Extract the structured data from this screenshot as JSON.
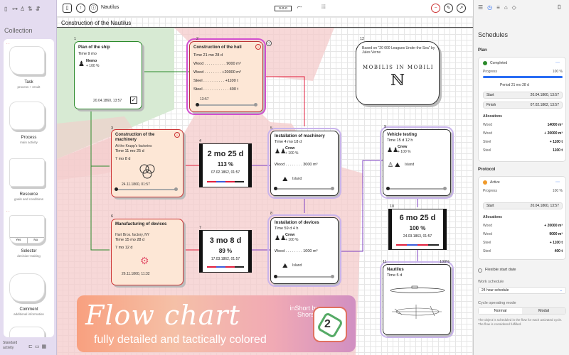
{
  "app": {
    "title": "Nautilus",
    "collection_label": "Collection"
  },
  "sidebar": {
    "shapes": [
      {
        "name": "Task",
        "sub": "process + result"
      },
      {
        "name": "Process",
        "sub": "main activity"
      },
      {
        "name": "Resource",
        "sub": "goals and conditions"
      },
      {
        "name": "Selector",
        "sub": "decision-making",
        "yes": "Yes",
        "no": "No"
      },
      {
        "name": "Comment",
        "sub": "additional information"
      }
    ],
    "footer": "Standard activity"
  },
  "canvas": {
    "title": "Construction of the Nautilus"
  },
  "nodes": {
    "plan": {
      "num": "1",
      "title": "Plan of the ship",
      "time": "Time 9 mo",
      "res": "Nemo",
      "pct": "+ 100 %",
      "date": "20.04.1860, 13:57"
    },
    "hull": {
      "num": "2",
      "title": "Construction of the hull",
      "time": "Time 21 mo 28 d",
      "wood": "Wood . . . . . . . . . . 9000 m³",
      "wood2": "Wood . . . . . . . . +20000 m³",
      "steel": "Steel . . . . . . . . . . +1100 t",
      "steel2": "Steel . . . . . . . . . . . . 400 t",
      "date": "13:57"
    },
    "machinery": {
      "num": "3",
      "title": "Construction of the machinery",
      "place": "At the Krupp's factories",
      "time": "Time 11 mo 25 d",
      "dur": "7 mo 8 d",
      "date": "24.11.1860, 01:57"
    },
    "dur1": {
      "num": "4",
      "big": "2 mo 25 d",
      "pct": "113 %",
      "date": "07.02.1862, 01:57"
    },
    "instmach": {
      "num": "5",
      "title": "Installation of machinery",
      "time": "Time 4 mo 18 d",
      "crew": "Crew",
      "pct": "+ 100 %",
      "wood": "Wood . . . . . . . . 3000 m³",
      "island": "Island"
    },
    "devices": {
      "num": "6",
      "title": "Manufacturing of devices",
      "place": "Hart Bros. factory, NY",
      "time": "Time 15 mo 28 d",
      "dur": "7 mo 12 d",
      "date": "26.11.1860, 11:32"
    },
    "dur2": {
      "num": "7",
      "big": "3 mo 8 d",
      "pct": "89 %",
      "date": "17.03.1862, 01:57"
    },
    "instdev": {
      "num": "8",
      "title": "Installation of devices",
      "time": "Time 59 d 4 h",
      "crew": "Crew",
      "pct": "+ 100 %",
      "wood": "Wood . . . . . . . . 1000 m³",
      "island": "Island"
    },
    "testing": {
      "num": "9",
      "title": "Vehicle testing",
      "time": "Time 15 d 12 h",
      "crew": "Crew",
      "pct": "+ 100 %",
      "island": "Island"
    },
    "dur3": {
      "num": "10",
      "big": "6 mo 25 d",
      "pct": "100 %",
      "date": "24.03.1863, 01:57"
    },
    "nautilus": {
      "num": "11",
      "title": "Nautilus",
      "time": "Time 5 d",
      "pct": "100%"
    },
    "note": {
      "num": "12",
      "text": "Based on \"20 000 Leagues Under the Sea\" by Jules Verne",
      "motto": "MOBILIS IN MOBILI"
    }
  },
  "banner": {
    "title": "Flow chart",
    "subtitle": "fully detailed and tactically colored",
    "brand": "inShort by Shorski"
  },
  "panel": {
    "header": "Schedules",
    "plan_label": "Plan",
    "plan_status": "Completed",
    "plan_progress_label": "Progress",
    "plan_progress_value": "100 %",
    "plan_progress_fraction": 1.0,
    "plan_period": "Period 21 mo 28 d",
    "plan_start": "Start",
    "plan_start_val": "20.04.1860, 13:57",
    "plan_finish": "Finish",
    "plan_finish_val": "07.02.1862, 13:57",
    "allocations_label": "Allocations",
    "alloc1": [
      {
        "name": "Wood",
        "val": "14000 m³"
      },
      {
        "name": "Wood",
        "val": "+ 20000 m³"
      },
      {
        "name": "Steel",
        "val": "+ 1100 t"
      },
      {
        "name": "Steel",
        "val": "1100 t"
      }
    ],
    "protocol_label": "Protocol",
    "proto_status": "Active",
    "proto_progress_label": "Progress",
    "proto_progress_value": "100 %",
    "proto_start": "Start",
    "proto_start_val": "20.04.1860, 13:57",
    "alloc2": [
      {
        "name": "Wood",
        "val": "+ 20000 m³"
      },
      {
        "name": "Wood",
        "val": "9000 m³"
      },
      {
        "name": "Steel",
        "val": "+ 1100 t"
      },
      {
        "name": "Steel",
        "val": "400 t"
      }
    ],
    "flexible": "Flexible start date",
    "work_schedule_label": "Work schedule",
    "work_schedule_value": "24 hour schedule",
    "cycle_label": "Cycle operating mode",
    "cycle_normal": "Normal",
    "cycle_modal": "Modal",
    "cycle_note": "The object is scheduled in the flow for each activated cycle. The flow is considered fulfilled."
  }
}
